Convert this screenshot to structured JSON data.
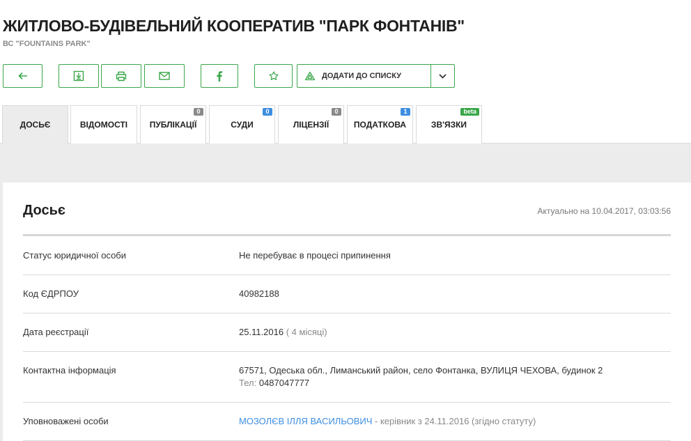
{
  "header": {
    "title": "ЖИТЛОВО-БУДІВЕЛЬНИЙ КООПЕРАТИВ \"ПАРК ФОНТАНІВ\"",
    "subtitle": "ВС \"FOUNTAINS PARK\""
  },
  "toolbar": {
    "back_icon": "arrow-left-icon",
    "download_icon": "download-icon",
    "print_icon": "printer-icon",
    "mail_icon": "envelope-icon",
    "facebook_icon": "facebook-icon",
    "favorite_icon": "star-icon",
    "add_to_list_label": "ДОДАТИ ДО СПИСКУ",
    "add_to_list_icon": "triangle-icon",
    "dropdown_icon": "chevron-down-icon"
  },
  "tabs": [
    {
      "label": "ДОСЬЄ",
      "badge": null
    },
    {
      "label": "ВІДОМОСТІ",
      "badge": null
    },
    {
      "label": "ПУБЛІКАЦІЇ",
      "badge": "0"
    },
    {
      "label": "СУДИ",
      "badge": "0"
    },
    {
      "label": "ЛІЦЕНЗІЇ",
      "badge": "0"
    },
    {
      "label": "ПОДАТКОВА",
      "badge": "1"
    },
    {
      "label": "ЗВ'ЯЗКИ",
      "badge": "beta"
    }
  ],
  "dossier": {
    "title": "Досьє",
    "updated": "Актуально на 10.04.2017, 03:03:56",
    "rows": {
      "status": {
        "label": "Статус юридичної особи",
        "value": "Не перебуває в процесі припинення"
      },
      "code": {
        "label": "Код ЄДРПОУ",
        "value": "40982188"
      },
      "reg_date": {
        "label": "Дата реєстрації",
        "value": "25.11.2016",
        "extra": "( 4 місяці)"
      },
      "contact": {
        "label": "Контактна інформація",
        "address": "67571, Одеська обл., Лиманський район, село Фонтанка, ВУЛИЦЯ ЧЕХОВА, будинок 2",
        "phone_label": "Тел:",
        "phone": "0487047777"
      },
      "persons": {
        "label": "Уповноважені особи",
        "name": "МОЗОЛЄВ ІЛЛЯ ВАСИЛЬОВИЧ",
        "role": "- керівник з 24.11.2016 (згідно статуту)"
      }
    }
  },
  "colors": {
    "accent": "#3aa64a",
    "link": "#3e8ee0",
    "badge_gray": "#8a8a8a"
  }
}
